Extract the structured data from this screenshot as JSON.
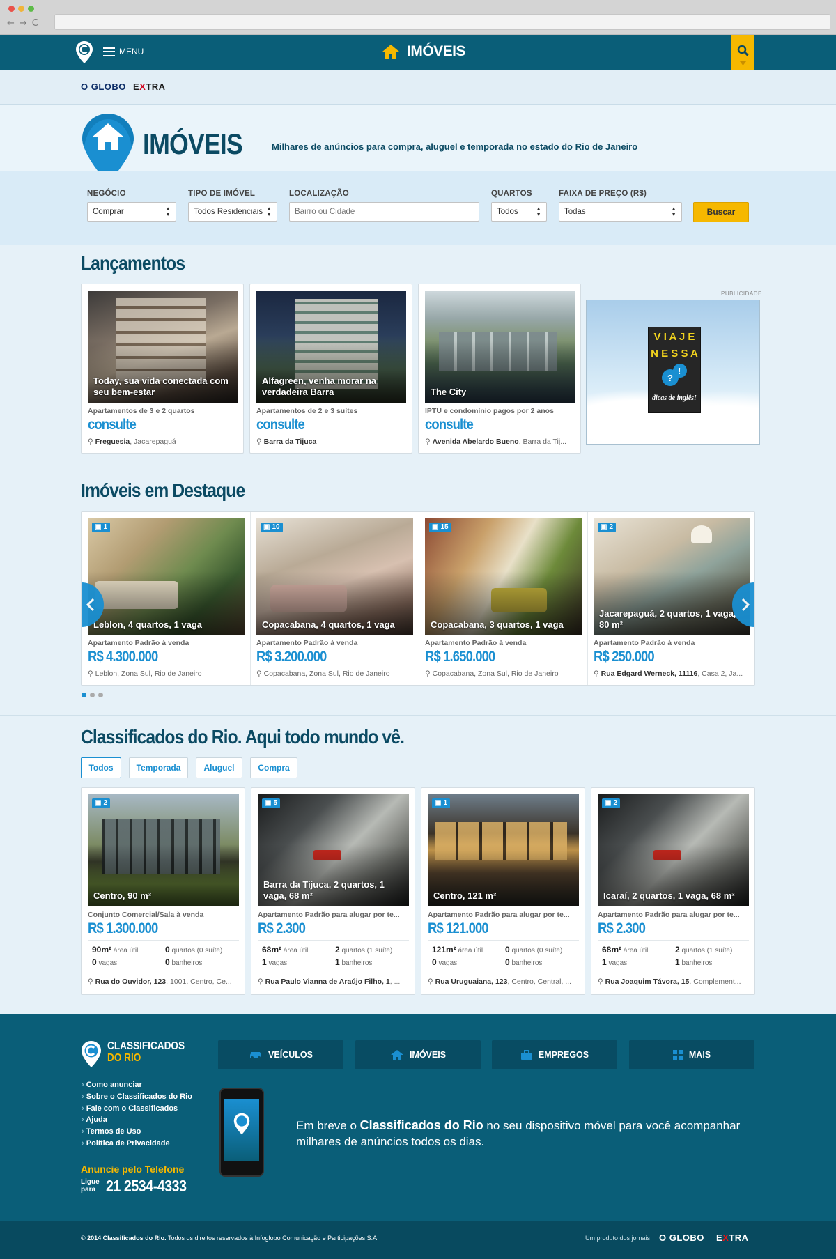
{
  "header": {
    "menu_label": "MENU",
    "section_title": "IMÓVEIS"
  },
  "brands": {
    "globo": "O GLOBO",
    "extra_pre": "E",
    "extra_x": "X",
    "extra_post": "TRA"
  },
  "hero": {
    "title": "IMÓVEIS",
    "tagline": "Milhares de anúncios para compra, aluguel e temporada no estado do Rio de Janeiro"
  },
  "search": {
    "negocio_label": "NEGÓCIO",
    "negocio_value": "Comprar",
    "tipo_label": "TIPO DE IMÓVEL",
    "tipo_value": "Todos Residenciais",
    "local_label": "LOCALIZAÇÃO",
    "local_placeholder": "Bairro ou Cidade",
    "quartos_label": "QUARTOS",
    "quartos_value": "Todos",
    "preco_label": "FAIXA DE PREÇO (R$)",
    "preco_value": "Todas",
    "button": "Buscar"
  },
  "lancamentos": {
    "title": "Lançamentos",
    "ad_label": "PUBLICIDADE",
    "ad_lines": [
      "V I A J E",
      "N E S S A"
    ],
    "ad_sub": "dicas de inglês!",
    "items": [
      {
        "caption": "Today, sua vida conectada com seu bem-estar",
        "sub": "Apartamentos de 3 e 2 quartos",
        "price": "consulte",
        "loc_b": "Freguesia",
        "loc_rest": ", Jacarepaguá"
      },
      {
        "caption": "Alfagreen, venha morar na verdadeira Barra",
        "sub": "Apartamentos de 2 e 3 suítes",
        "price": "consulte",
        "loc_b": "Barra da Tijuca",
        "loc_rest": ""
      },
      {
        "caption": "The City",
        "sub": "IPTU e condomínio pagos por 2 anos",
        "price": "consulte",
        "loc_b": "Avenida Abelardo Bueno",
        "loc_rest": ", Barra da Tij..."
      }
    ]
  },
  "destaque": {
    "title": "Imóveis em Destaque",
    "items": [
      {
        "count": "1",
        "caption": "Leblon, 4 quartos, 1 vaga",
        "sub": "Apartamento Padrão à venda",
        "price": "R$ 4.300.000",
        "loc": "Leblon, Zona Sul, Rio de Janeiro"
      },
      {
        "count": "10",
        "caption": "Copacabana, 4 quartos, 1 vaga",
        "sub": "Apartamento Padrão à venda",
        "price": "R$ 3.200.000",
        "loc": "Copacabana, Zona Sul, Rio de Janeiro"
      },
      {
        "count": "15",
        "caption": "Copacabana, 3 quartos, 1 vaga",
        "sub": "Apartamento Padrão à venda",
        "price": "R$ 1.650.000",
        "loc": "Copacabana, Zona Sul, Rio de Janeiro"
      },
      {
        "count": "2",
        "caption": "Jacarepaguá, 2 quartos, 1 vaga, 80 m²",
        "sub": "Apartamento Padrão à venda",
        "price": "R$ 250.000",
        "loc_b": "Rua Edgard Werneck, 11116",
        "loc": ", Casa 2, Ja..."
      }
    ]
  },
  "classificados": {
    "title": "Classificados do Rio. Aqui todo mundo vê.",
    "tabs": [
      "Todos",
      "Temporada",
      "Aluguel",
      "Compra"
    ],
    "items": [
      {
        "count": "2",
        "caption": "Centro, 90 m²",
        "sub": "Conjunto Comercial/Sala à venda",
        "price": "R$ 1.300.000",
        "area": "90m²",
        "area_l": "área útil",
        "quartos": "0",
        "quartos_l": "quartos (0 suíte)",
        "vagas": "0",
        "vagas_l": "vagas",
        "banheiros": "0",
        "banheiros_l": "banheiros",
        "loc_b": "Rua do Ouvidor, 123",
        "loc": ", 1001, Centro, Ce..."
      },
      {
        "count": "5",
        "caption": "Barra da Tijuca, 2 quartos, 1 vaga, 68 m²",
        "sub": "Apartamento Padrão para alugar por te...",
        "price": "R$ 2.300",
        "area": "68m²",
        "area_l": "área útil",
        "quartos": "2",
        "quartos_l": "quartos (1 suíte)",
        "vagas": "1",
        "vagas_l": "vagas",
        "banheiros": "1",
        "banheiros_l": "banheiros",
        "loc_b": "Rua Paulo Vianna de Araújo Filho, 1",
        "loc": ", ..."
      },
      {
        "count": "1",
        "caption": "Centro, 121 m²",
        "sub": "Apartamento Padrão para alugar por te...",
        "price": "R$ 121.000",
        "area": "121m²",
        "area_l": "área útil",
        "quartos": "0",
        "quartos_l": "quartos (0 suíte)",
        "vagas": "0",
        "vagas_l": "vagas",
        "banheiros": "0",
        "banheiros_l": "banheiros",
        "loc_b": "Rua Uruguaiana, 123",
        "loc": ", Centro, Central, ..."
      },
      {
        "count": "2",
        "caption": "Icaraí, 2 quartos, 1 vaga, 68 m²",
        "sub": "Apartamento Padrão para alugar por te...",
        "price": "R$ 2.300",
        "area": "68m²",
        "area_l": "área útil",
        "quartos": "2",
        "quartos_l": "quartos (1 suíte)",
        "vagas": "1",
        "vagas_l": "vagas",
        "banheiros": "1",
        "banheiros_l": "banheiros",
        "loc_b": "Rua Joaquim Távora, 15",
        "loc": ", Complement..."
      }
    ]
  },
  "footer": {
    "logo_line1": "CLASSIFICADOS",
    "logo_line2": "DO RIO",
    "links": [
      "Como anunciar",
      "Sobre o Classificados do Rio",
      "Fale com o Classificados",
      "Ajuda",
      "Termos de Uso",
      "Política de Privacidade"
    ],
    "nav": [
      "VEÍCULOS",
      "IMÓVEIS",
      "EMPREGOS",
      "MAIS"
    ],
    "promo_pre": "Em breve o ",
    "promo_b": "Classificados do Rio",
    "promo_post": " no seu dispositivo móvel para você acompanhar milhares de anúncios todos os dias.",
    "phone_heading": "Anuncie pelo Telefone",
    "ligue": "Ligue",
    "para": "para",
    "phone": "21 2534-4333",
    "copyright_b": "© 2014 Classificados do Rio.",
    "copyright": " Todos os direitos reservados à Infoglobo Comunicação e Participações S.A.",
    "produto": "Um produto dos jornais",
    "globo": "O GLOBO"
  },
  "colors": {
    "primary": "#0a5e78",
    "accent": "#1a8fd1",
    "yellow": "#f6b800"
  }
}
